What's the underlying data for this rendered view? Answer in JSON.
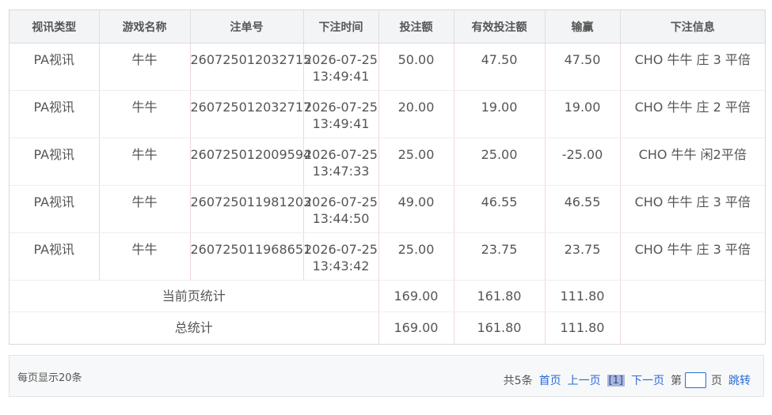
{
  "table": {
    "headers": [
      "视讯类型",
      "游戏名称",
      "注单号",
      "下注时间",
      "投注额",
      "有效投注额",
      "输赢",
      "下注信息"
    ],
    "rows": [
      {
        "type": "PA视讯",
        "game": "牛牛",
        "bet_no": "260725012032715",
        "date": "2026-07-25",
        "time": "13:49:41",
        "amount": "50.00",
        "valid": "47.50",
        "win": "47.50",
        "info": "CHO 牛牛 庄 3 平倍"
      },
      {
        "type": "PA视讯",
        "game": "牛牛",
        "bet_no": "260725012032717",
        "date": "2026-07-25",
        "time": "13:49:41",
        "amount": "20.00",
        "valid": "19.00",
        "win": "19.00",
        "info": "CHO 牛牛 庄 2 平倍"
      },
      {
        "type": "PA视讯",
        "game": "牛牛",
        "bet_no": "260725012009594",
        "date": "2026-07-25",
        "time": "13:47:33",
        "amount": "25.00",
        "valid": "25.00",
        "win": "-25.00",
        "info": "CHO 牛牛 闲2平倍"
      },
      {
        "type": "PA视讯",
        "game": "牛牛",
        "bet_no": "260725011981203",
        "date": "2026-07-25",
        "time": "13:44:50",
        "amount": "49.00",
        "valid": "46.55",
        "win": "46.55",
        "info": "CHO 牛牛 庄 3 平倍"
      },
      {
        "type": "PA视讯",
        "game": "牛牛",
        "bet_no": "260725011968651",
        "date": "2026-07-25",
        "time": "13:43:42",
        "amount": "25.00",
        "valid": "23.75",
        "win": "23.75",
        "info": "CHO 牛牛 庄 3 平倍"
      }
    ],
    "page_summary": {
      "label": "当前页统计",
      "amount": "169.00",
      "valid": "161.80",
      "win": "111.80"
    },
    "total_summary": {
      "label": "总统计",
      "amount": "169.00",
      "valid": "161.80",
      "win": "111.80"
    }
  },
  "footer": {
    "per_page": "每页显示20条",
    "total": "共5条",
    "first": "首页",
    "prev": "上一页",
    "current_page": "[1]",
    "next": "下一页",
    "goto_prefix": "第",
    "goto_suffix": "页",
    "jump": "跳转"
  }
}
